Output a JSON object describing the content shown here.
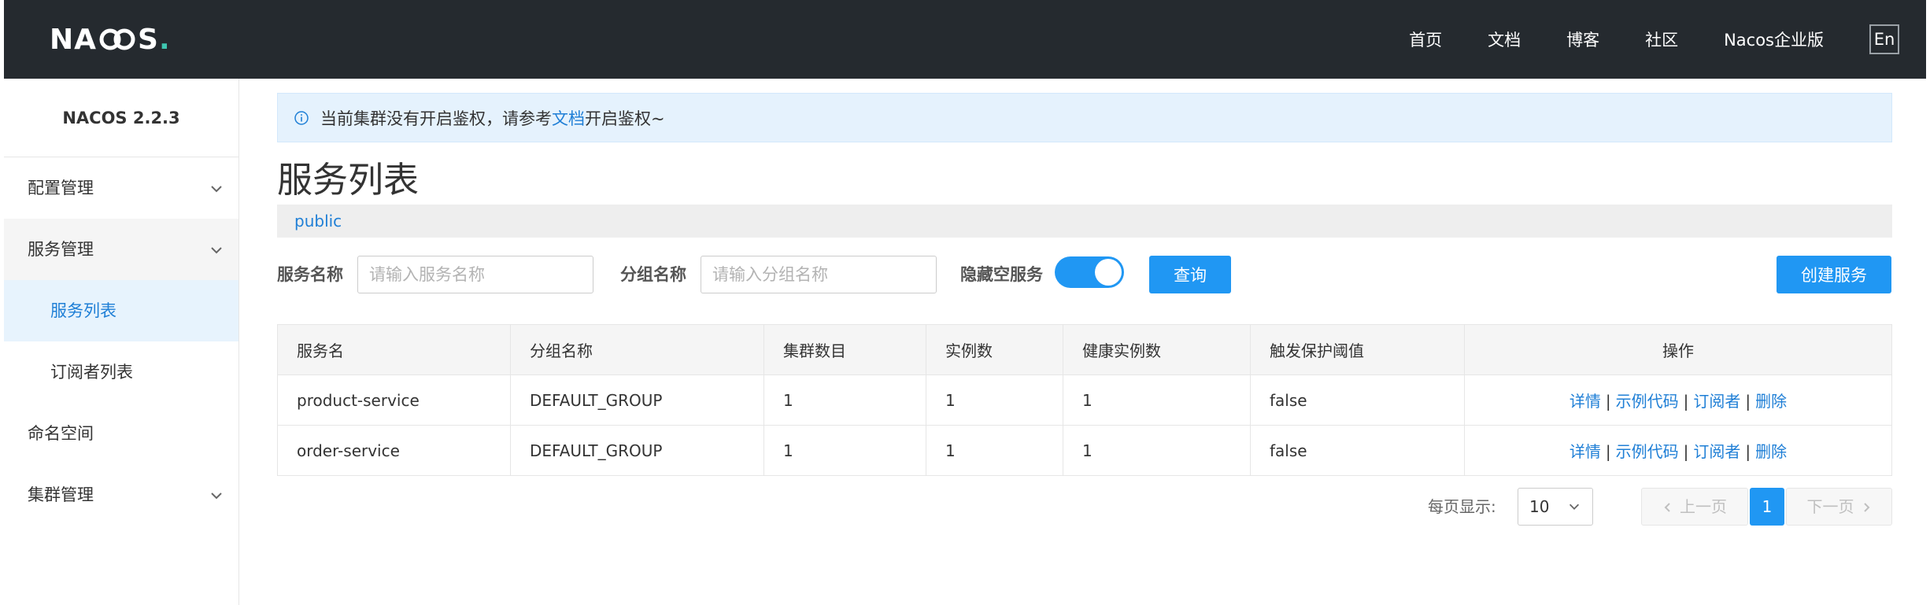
{
  "header": {
    "logo_prefix": "NA",
    "logo_suffix": "S",
    "logo_dot": ".",
    "nav": [
      "首页",
      "文档",
      "博客",
      "社区",
      "Nacos企业版"
    ],
    "lang_button": "En"
  },
  "sidebar": {
    "version": "NACOS 2.2.3",
    "items": [
      {
        "label": "配置管理"
      },
      {
        "label": "服务管理"
      },
      {
        "label": "服务列表"
      },
      {
        "label": "订阅者列表"
      },
      {
        "label": "命名空间"
      },
      {
        "label": "集群管理"
      }
    ]
  },
  "notice": {
    "text_before": "当前集群没有开启鉴权，请参考",
    "link": "文档",
    "text_after": "开启鉴权~"
  },
  "page": {
    "title": "服务列表",
    "namespace": "public"
  },
  "filters": {
    "service_label": "服务名称",
    "service_placeholder": "请输入服务名称",
    "group_label": "分组名称",
    "group_placeholder": "请输入分组名称",
    "hide_empty_label": "隐藏空服务",
    "hide_empty_on": true,
    "query_button": "查询",
    "create_button": "创建服务"
  },
  "table": {
    "headers": [
      "服务名",
      "分组名称",
      "集群数目",
      "实例数",
      "健康实例数",
      "触发保护阈值",
      "操作"
    ],
    "rows": [
      [
        "product-service",
        "DEFAULT_GROUP",
        "1",
        "1",
        "1",
        "false"
      ],
      [
        "order-service",
        "DEFAULT_GROUP",
        "1",
        "1",
        "1",
        "false"
      ]
    ],
    "actions": [
      "详情",
      "示例代码",
      "订阅者",
      "删除"
    ],
    "separator": "|"
  },
  "pagination": {
    "page_size_label": "每页显示:",
    "page_size": "10",
    "prev": "上一页",
    "current": "1",
    "next": "下一页"
  },
  "colors": {
    "header_bg": "#252a2f",
    "primary": "#2097f3",
    "link": "#1f7fd6",
    "notice_bg": "#e5f2fd"
  }
}
